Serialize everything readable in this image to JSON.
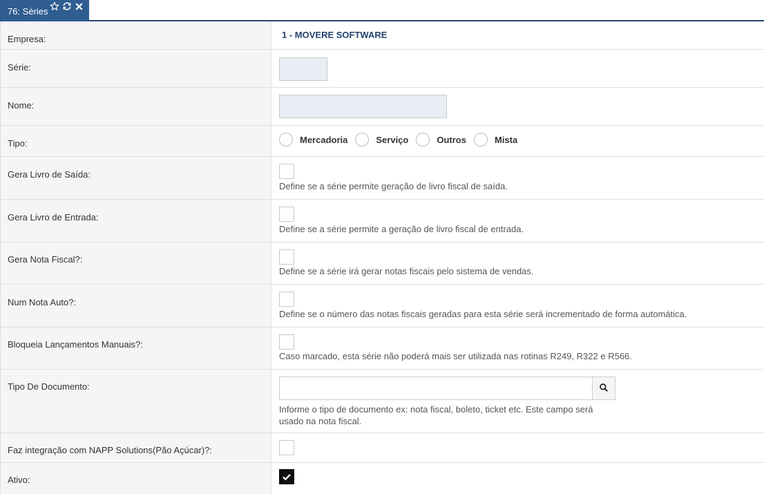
{
  "tab": {
    "title": "76: Séries",
    "icons": [
      "star-icon",
      "refresh-icon",
      "close-icon"
    ]
  },
  "fields": {
    "empresa": {
      "label": "Empresa:",
      "value": "1 - MOVERE SOFTWARE"
    },
    "serie": {
      "label": "Série:",
      "value": ""
    },
    "nome": {
      "label": "Nome:",
      "value": ""
    },
    "tipo": {
      "label": "Tipo:",
      "options": [
        "Mercadoria",
        "Serviço",
        "Outros",
        "Mista"
      ]
    },
    "gera_livro_saida": {
      "label": "Gera Livro de Saída:",
      "checked": false,
      "hint": "Define se a série permite geração de livro fiscal de saída."
    },
    "gera_livro_entrada": {
      "label": "Gera Livro de Entrada:",
      "checked": false,
      "hint": "Define se a série permite a geração de livro fiscal de entrada."
    },
    "gera_nota_fiscal": {
      "label": "Gera Nota Fiscal?:",
      "checked": false,
      "hint": "Define se a série irá gerar notas fiscais pelo sistema de vendas."
    },
    "num_nota_auto": {
      "label": "Num Nota Auto?:",
      "checked": false,
      "hint": "Define se o número das notas fiscais geradas para esta série será incrementado de forma automática."
    },
    "bloqueia_lancamentos": {
      "label": "Bloqueia Lançamentos Manuais?:",
      "checked": false,
      "hint": "Caso marcado, esta série não poderá mais ser utilizada nas rotinas R249, R322 e R566."
    },
    "tipo_documento": {
      "label": "Tipo De Documento:",
      "value": "",
      "hint_line1": "Informe o tipo de documento ex: nota fiscal, boleto, ticket etc. Este campo será",
      "hint_line2": "usado na nota fiscal."
    },
    "integracao_napp": {
      "label": "Faz integração com NAPP Solutions(Pão Açúcar)?:",
      "checked": false
    },
    "ativo": {
      "label": "Ativo:",
      "checked": true
    }
  },
  "colors": {
    "tab_bg": "#2f5d90",
    "tab_border": "#24446e",
    "company_text": "#24446e",
    "label_bg": "#f5f5f5",
    "input_bg": "#e8eef3"
  }
}
